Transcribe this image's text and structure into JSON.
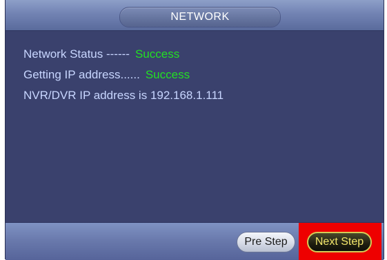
{
  "window": {
    "title": "NETWORK"
  },
  "status": {
    "network_label": "Network Status ------",
    "network_value": "Success",
    "ip_label": "Getting IP address......",
    "ip_value": "Success",
    "address_label": "NVR/DVR IP address is",
    "address_value": "192.168.1.111"
  },
  "footer": {
    "pre_label": "Pre Step",
    "next_label": "Next Step"
  },
  "colors": {
    "panel_bg": "#3a416d",
    "label_text": "#c8d6ff",
    "success_text": "#23e023",
    "highlight": "#ee0000"
  }
}
